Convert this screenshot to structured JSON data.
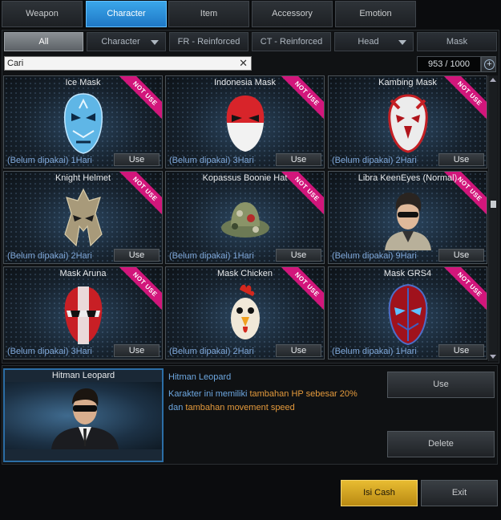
{
  "tabs": [
    {
      "label": "Weapon",
      "active": false
    },
    {
      "label": "Character",
      "active": true
    },
    {
      "label": "Item",
      "active": false
    },
    {
      "label": "Accessory",
      "active": false
    },
    {
      "label": "Emotion",
      "active": false
    }
  ],
  "filters": [
    {
      "label": "All",
      "active": true,
      "dropdown": false
    },
    {
      "label": "Character",
      "active": false,
      "dropdown": true
    },
    {
      "label": "FR - Reinforced",
      "active": false,
      "dropdown": false
    },
    {
      "label": "CT - Reinforced",
      "active": false,
      "dropdown": false
    },
    {
      "label": "Head",
      "active": false,
      "dropdown": true
    },
    {
      "label": "Mask",
      "active": false,
      "dropdown": false
    }
  ],
  "search": {
    "placeholder": "Cari",
    "value": "Cari",
    "clear_icon": "close-icon"
  },
  "inventory_count": "953 / 1000",
  "ribbon_label": "NOT USE",
  "use_label": "Use",
  "items": [
    {
      "name": "Ice Mask",
      "duration": "(Belum dipakai) 1Hari",
      "art": "ice-mask"
    },
    {
      "name": "Indonesia Mask",
      "duration": "(Belum dipakai) 3Hari",
      "art": "indonesia-mask"
    },
    {
      "name": "Kambing Mask",
      "duration": "(Belum dipakai) 2Hari",
      "art": "kambing-mask"
    },
    {
      "name": "Knight Helmet",
      "duration": "(Belum dipakai) 2Hari",
      "art": "knight-helmet"
    },
    {
      "name": "Kopassus Boonie Hat",
      "duration": "(Belum dipakai) 1Hari",
      "art": "boonie-hat"
    },
    {
      "name": "Libra KeenEyes (Normal)",
      "duration": "(Belum dipakai) 9Hari",
      "art": "character-portrait"
    },
    {
      "name": "Mask Aruna",
      "duration": "(Belum dipakai) 3Hari",
      "art": "aruna-mask"
    },
    {
      "name": "Mask Chicken",
      "duration": "(Belum dipakai) 2Hari",
      "art": "chicken-mask"
    },
    {
      "name": "Mask GRS4",
      "duration": "(Belum dipakai) 1Hari",
      "art": "grs4-mask"
    }
  ],
  "detail": {
    "preview_title": "Hitman Leopard",
    "name": "Hitman Leopard",
    "desc_part1": "Karakter ini memiliki ",
    "desc_highlight1": "tambahan HP sebesar 20%",
    "desc_part2": "dan ",
    "desc_highlight2": "tambahan movement speed"
  },
  "actions": {
    "use": "Use",
    "delete": "Delete",
    "isi_cash": "Isi Cash",
    "exit": "Exit"
  },
  "colors": {
    "accent": "#2a8fdc",
    "ribbon": "#d2167b",
    "gold": "#e0b02a",
    "desc_blue": "#6da7e0",
    "desc_orange": "#e49a3c"
  }
}
